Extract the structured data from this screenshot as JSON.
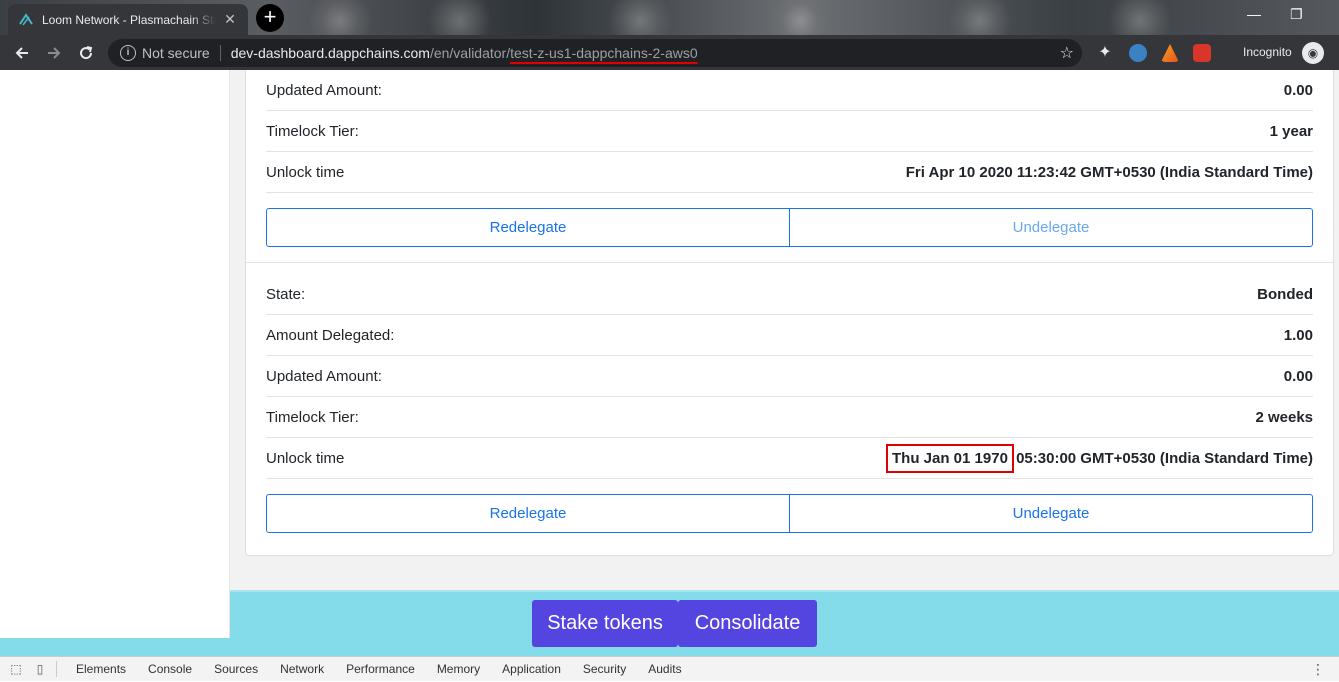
{
  "browser": {
    "tab_title": "Loom Network - Plasmachain Sta",
    "tab_close": "✕",
    "new_tab": "+",
    "security_label": "Not secure",
    "url_host": "dev-dashboard.dappchains.com",
    "url_path": "/en/validator/",
    "url_highlight": "test-z-us1-dappchains-2-aws0",
    "incognito_label": "Incognito",
    "controls": {
      "minimize": "—",
      "maximize": "❐"
    },
    "icons": [
      "back-arrow-icon",
      "forward-arrow-icon",
      "reload-icon",
      "info-icon",
      "star-icon",
      "extension-icon",
      "incognito-icon"
    ]
  },
  "delegations": [
    {
      "rows": [
        {
          "label": "Updated Amount:",
          "value": "0.00"
        },
        {
          "label": "Timelock Tier:",
          "value": "1 year"
        },
        {
          "label": "Unlock time",
          "value": "Fri Apr 10 2020 11:23:42 GMT+0530 (India Standard Time)"
        }
      ],
      "redelegate": "Redelegate",
      "undelegate": "Undelegate",
      "undelegate_enabled": false
    },
    {
      "rows": [
        {
          "label": "State:",
          "value": "Bonded"
        },
        {
          "label": "Amount Delegated:",
          "value": "1.00"
        },
        {
          "label": "Updated Amount:",
          "value": "0.00"
        },
        {
          "label": "Timelock Tier:",
          "value": "2 weeks"
        }
      ],
      "unlock_label": "Unlock time",
      "unlock_value_boxed": "Thu Jan 01 1970",
      "unlock_value_rest": " 05:30:00 GMT+0530 (India Standard Time)",
      "redelegate": "Redelegate",
      "undelegate": "Undelegate",
      "undelegate_enabled": true
    }
  ],
  "actions": {
    "stake": "Stake tokens",
    "consolidate": "Consolidate"
  },
  "devtools": {
    "tabs": [
      "Elements",
      "Console",
      "Sources",
      "Network",
      "Performance",
      "Memory",
      "Application",
      "Security",
      "Audits"
    ],
    "active_tab": "Console"
  },
  "colors": {
    "accent_blue": "#1a73e8",
    "action_purple": "#5445e0",
    "action_bar": "#84dbe9",
    "highlight_red": "#e00000"
  }
}
